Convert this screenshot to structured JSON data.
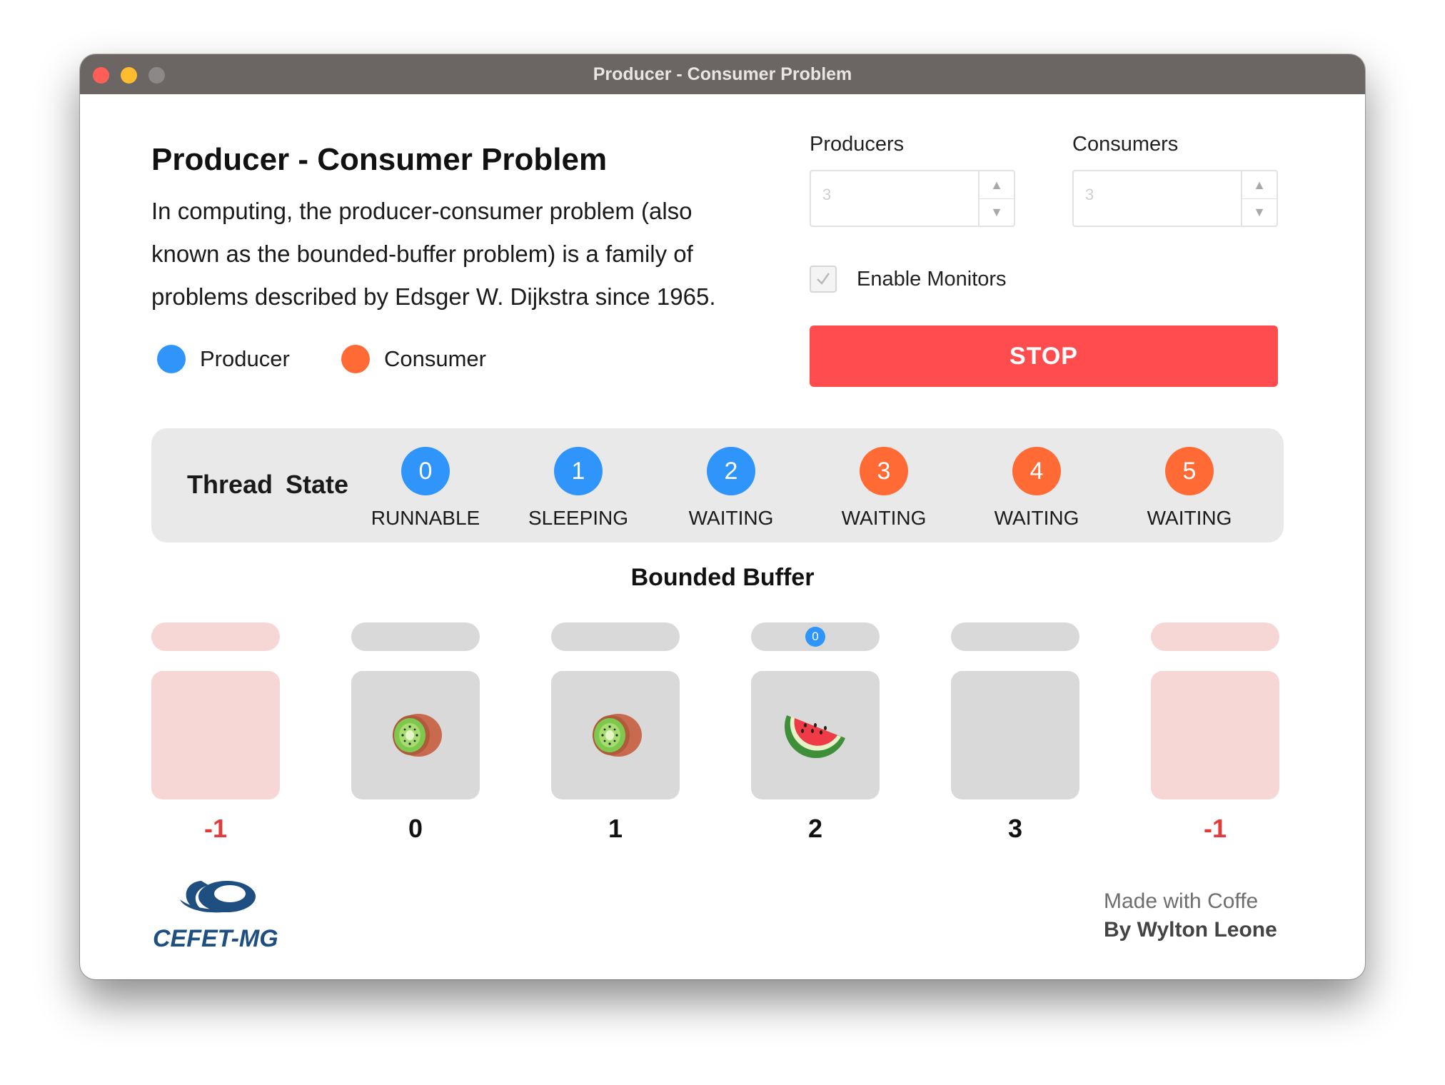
{
  "window": {
    "title": "Producer - Consumer Problem"
  },
  "intro": {
    "heading": "Producer - Consumer Problem",
    "description": "In computing, the producer-consumer problem (also known as the bounded-buffer problem) is a family of problems described by Edsger W. Dijkstra since 1965."
  },
  "legend": {
    "producer_label": "Producer",
    "consumer_label": "Consumer",
    "producer_color": "#2f95fb",
    "consumer_color": "#ff6a35"
  },
  "controls": {
    "producers_label": "Producers",
    "producers_value": "3",
    "consumers_label": "Consumers",
    "consumers_value": "3",
    "monitors_label": "Enable Monitors",
    "monitors_checked": true,
    "stop_label": "STOP"
  },
  "thread_state": {
    "title": "Thread State",
    "threads": [
      {
        "id": "0",
        "state": "RUNNABLE",
        "kind": "producer"
      },
      {
        "id": "1",
        "state": "SLEEPING",
        "kind": "producer"
      },
      {
        "id": "2",
        "state": "WAITING",
        "kind": "producer"
      },
      {
        "id": "3",
        "state": "WAITING",
        "kind": "consumer"
      },
      {
        "id": "4",
        "state": "WAITING",
        "kind": "consumer"
      },
      {
        "id": "5",
        "state": "WAITING",
        "kind": "consumer"
      }
    ]
  },
  "buffer": {
    "title": "Bounded Buffer",
    "slots": [
      {
        "index": "-1",
        "invalid": true,
        "item": "",
        "badge": ""
      },
      {
        "index": "0",
        "invalid": false,
        "item": "kiwi",
        "badge": ""
      },
      {
        "index": "1",
        "invalid": false,
        "item": "kiwi",
        "badge": ""
      },
      {
        "index": "2",
        "invalid": false,
        "item": "watermelon",
        "badge": "0"
      },
      {
        "index": "3",
        "invalid": false,
        "item": "",
        "badge": ""
      },
      {
        "index": "-1",
        "invalid": true,
        "item": "",
        "badge": ""
      }
    ]
  },
  "footer": {
    "logo_text": "CEFET-MG",
    "credit_line1": "Made with Coffe",
    "credit_line2": "By Wylton Leone"
  }
}
